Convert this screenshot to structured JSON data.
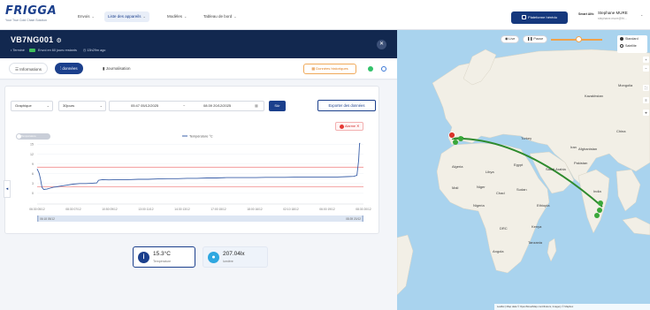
{
  "nav": {
    "logo": "FRIGGA",
    "tagline": "Your True Cold Chain Solution",
    "items": [
      {
        "label": "Envois",
        "active": false
      },
      {
        "label": "Liste des appareils",
        "active": true
      },
      {
        "label": "Modèles",
        "active": false
      },
      {
        "label": "Tableau de bord",
        "active": false
      }
    ],
    "platform_button": "Plateforme hérédo",
    "brand_mini": "Smart Alfo",
    "user_name": "Stephane MURE",
    "user_sub": "stephane.mure@fri..."
  },
  "device": {
    "id": "VB7NG001",
    "meta_prefix": "• Terminé",
    "meta_status": "Envoi en 60 jours restants",
    "meta_time": "13h29m ago"
  },
  "tabs": [
    {
      "label": "Informations",
      "icon": "list-icon",
      "active": false
    },
    {
      "label": "données",
      "icon": "chart-icon",
      "active": true
    },
    {
      "label": "Journalisation",
      "icon": "doc-icon",
      "active": false
    }
  ],
  "history_button": "Données historiques",
  "controls": {
    "view_mode": "Graphique",
    "period": "30jours",
    "date_start": "05:47 05/12/2025",
    "date_sep": "~",
    "date_end": "08:39 20/12/2025",
    "ok": "Sûr",
    "export": "Exporter des données"
  },
  "alarm_chip": "Alarme",
  "toggle_label": "Température",
  "reading_temp": {
    "value": "15.3°C",
    "label": "Température"
  },
  "reading_light": {
    "value": "207.04lx",
    "label": "lumière"
  },
  "map": {
    "live": "Live",
    "pause": "Pause",
    "layer_standard": "Standard",
    "layer_satellite": "Satellite",
    "footer": "Leaflet | Map data © OpenStreetMap contributors, Imagery © Mapbox"
  },
  "geo_labels": [
    {
      "text": "Kazakhstan"
    },
    {
      "text": "Mongolia"
    },
    {
      "text": "China"
    },
    {
      "text": "Algeria"
    },
    {
      "text": "Libya"
    },
    {
      "text": "Egypt"
    },
    {
      "text": "Saudi Arabia"
    },
    {
      "text": "Iran"
    },
    {
      "text": "India"
    },
    {
      "text": "Pakistan"
    },
    {
      "text": "Mali"
    },
    {
      "text": "Niger"
    },
    {
      "text": "Chad"
    },
    {
      "text": "Sudan"
    },
    {
      "text": "Nigeria"
    },
    {
      "text": "Ethiopia"
    },
    {
      "text": "Kenya"
    },
    {
      "text": "Tanzania"
    },
    {
      "text": "DRC"
    },
    {
      "text": "Angola"
    },
    {
      "text": "Turkey"
    },
    {
      "text": "Afghanistan"
    }
  ],
  "chart_data": {
    "type": "line",
    "legend": [
      "Température °C"
    ],
    "y_ticks": [
      15,
      12,
      9,
      6,
      3,
      0
    ],
    "x_ticks": [
      "06:30 05/12",
      "08:30 07/12",
      "10:50 09/12",
      "13:00 11/12",
      "14:30 13/12",
      "17:00 15/12",
      "18:00 16/12",
      "02:10 18/12",
      "06:00 19/12",
      "08:30 20/12"
    ],
    "ylim": [
      -3,
      17
    ],
    "upper_alarm": 8,
    "lower_alarm": 2,
    "range_start": "06:18 05/12",
    "range_end": "08:39 20/12",
    "series": [
      {
        "points": [
          [
            0,
            7.5
          ],
          [
            0.6,
            6.2
          ],
          [
            1,
            4.5
          ],
          [
            1.5,
            1.8
          ],
          [
            2,
            1.2
          ],
          [
            3,
            1.3
          ],
          [
            4,
            1.6
          ],
          [
            5,
            1.9
          ],
          [
            6,
            2.0
          ],
          [
            7,
            2.2
          ],
          [
            9,
            2.5
          ],
          [
            11,
            2.8
          ],
          [
            13,
            3.0
          ],
          [
            15,
            3.0
          ],
          [
            17,
            3.1
          ],
          [
            18.3,
            3.2
          ],
          [
            18.8,
            4.0
          ],
          [
            20,
            4.2
          ],
          [
            22,
            4.1
          ],
          [
            25,
            4.2
          ],
          [
            28,
            4.2
          ],
          [
            31,
            4.3
          ],
          [
            34,
            4.3
          ],
          [
            37,
            4.4
          ],
          [
            40,
            4.5
          ],
          [
            43,
            4.5
          ],
          [
            46,
            4.6
          ],
          [
            49,
            4.6
          ],
          [
            52,
            4.7
          ],
          [
            55,
            4.7
          ],
          [
            58,
            4.8
          ],
          [
            61,
            4.8
          ],
          [
            64,
            4.8
          ],
          [
            67,
            4.8
          ],
          [
            70,
            4.9
          ],
          [
            73,
            4.9
          ],
          [
            76,
            4.9
          ],
          [
            80,
            5.0
          ],
          [
            84,
            5.0
          ],
          [
            88,
            5.0
          ],
          [
            92,
            5.0
          ],
          [
            95,
            5.1
          ],
          [
            97,
            5.2
          ],
          [
            98,
            5.5
          ],
          [
            98.5,
            10
          ],
          [
            98.8,
            15.3
          ],
          [
            99,
            15.3
          ]
        ]
      }
    ]
  }
}
